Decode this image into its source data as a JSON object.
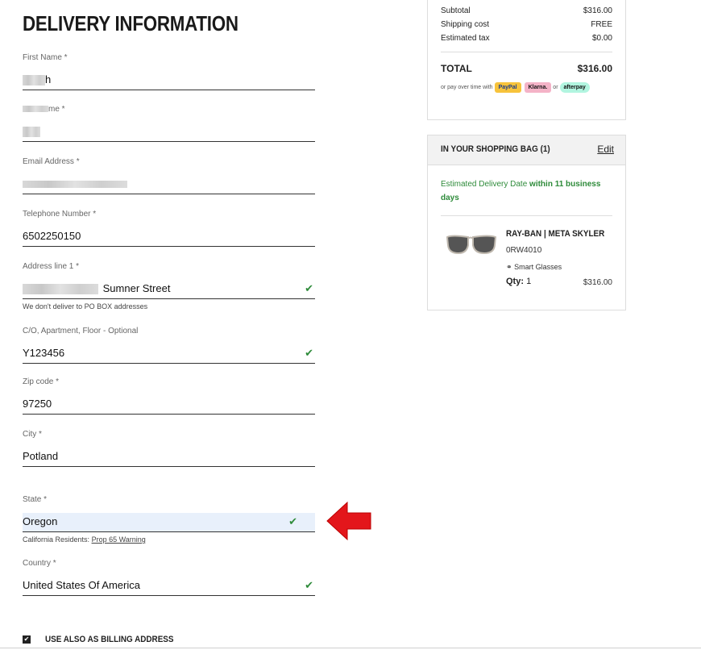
{
  "page_title": "DELIVERY INFORMATION",
  "form": {
    "first_name": {
      "label": "First Name *",
      "value": "h"
    },
    "last_name": {
      "label": "me *",
      "value": ""
    },
    "email": {
      "label": "Email Address *",
      "value": ""
    },
    "telephone": {
      "label": "Telephone Number *",
      "value": "6502250150"
    },
    "address1": {
      "label": "Address line 1 *",
      "value": "Sumner Street",
      "hint": "We don't deliver to PO BOX addresses"
    },
    "address2": {
      "label": "C/O, Apartment, Floor - Optional",
      "value": "Y123456"
    },
    "zip": {
      "label": "Zip code *",
      "value": "97250"
    },
    "city": {
      "label": "City *",
      "value": "Potland"
    },
    "state": {
      "label": "State *",
      "value": "Oregon",
      "hint_prefix": "California Residents:",
      "hint_link": "Prop 65 Warning"
    },
    "country": {
      "label": "Country *",
      "value": "United States Of America"
    },
    "billing_label": "USE ALSO AS BILLING ADDRESS"
  },
  "summary": {
    "subtotal_label": "Subtotal",
    "subtotal_value": "$316.00",
    "shipping_label": "Shipping cost",
    "shipping_value": "FREE",
    "tax_label": "Estimated tax",
    "tax_value": "$0.00",
    "total_label": "TOTAL",
    "total_value": "$316.00",
    "pay_over_time": "or pay over time with",
    "paypal": "PayPal",
    "klarna": "Klarna.",
    "or": "or",
    "afterpay": "afterpay"
  },
  "bag": {
    "title": "IN YOUR SHOPPING BAG (1)",
    "edit": "Edit",
    "delivery_prefix": "Estimated Delivery Date",
    "delivery_bold": "within 11 business days",
    "product_name": "RAY-BAN | META SKYLER",
    "product_code": "0RW4010",
    "product_type": "Smart Glasses",
    "qty_label": "Qty:",
    "qty_value": "1",
    "price": "$316.00"
  },
  "colors": {
    "check": "#2e8b3a",
    "arrow": "#e3161b",
    "state_bg": "#e8f0fb"
  }
}
